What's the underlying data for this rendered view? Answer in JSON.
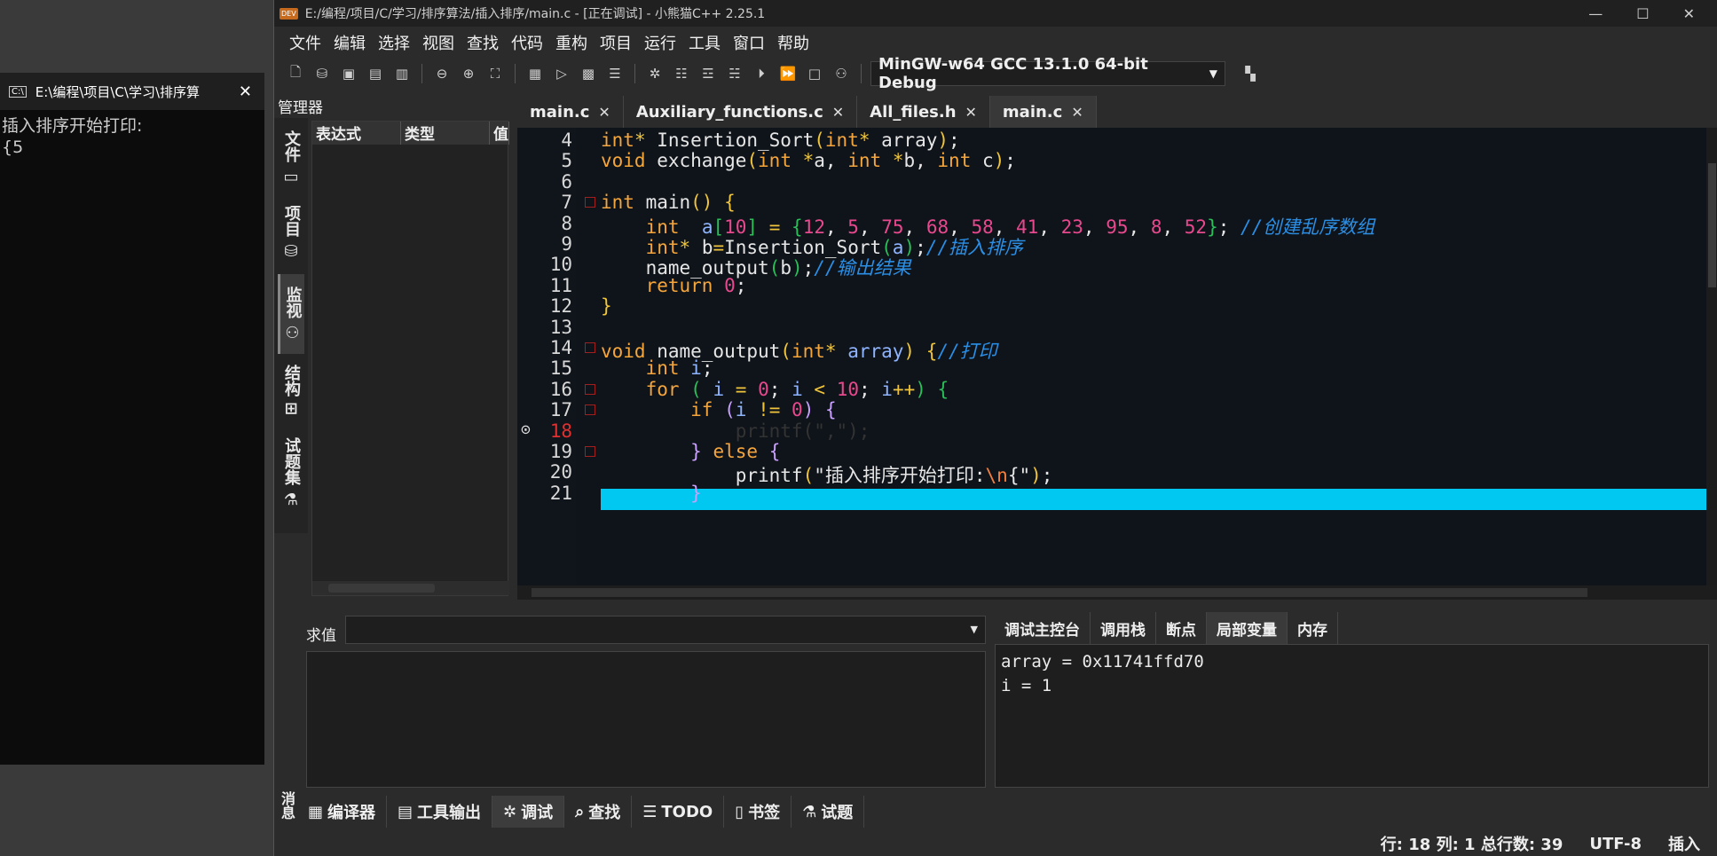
{
  "console": {
    "title": "E:\\编程\\项目\\C\\学习\\排序算",
    "icon_label": "C:\\",
    "lines": "插入排序开始打印:\n{5"
  },
  "window": {
    "title": "E:/编程/项目/C/学习/排序算法/插入排序/main.c - [正在调试] - 小熊猫C++ 2.25.1",
    "logo": "DEV"
  },
  "menu": [
    "文件",
    "编辑",
    "选择",
    "视图",
    "查找",
    "代码",
    "重构",
    "项目",
    "运行",
    "工具",
    "窗口",
    "帮助"
  ],
  "toolbar": {
    "compiler": "MinGW-w64 GCC 13.1.0 64-bit Debug"
  },
  "left_panel": {
    "title": "管理器",
    "vtabs": [
      "文件",
      "项目",
      "监视",
      "结构",
      "试题集"
    ],
    "watch_columns": [
      "表达式",
      "类型",
      "值"
    ]
  },
  "tabs": [
    {
      "label": "main.c",
      "active": false
    },
    {
      "label": "Auxiliary_functions.c",
      "active": false
    },
    {
      "label": "All_files.h",
      "active": false
    },
    {
      "label": "main.c",
      "active": true
    }
  ],
  "editor": {
    "line_numbers": [
      "4",
      "5",
      "6",
      "7",
      "8",
      "9",
      "10",
      "11",
      "12",
      "13",
      "14",
      "15",
      "16",
      "17",
      "18",
      "19",
      "20",
      "21"
    ],
    "current_line": "18",
    "highlight_color": "#00c8f0"
  },
  "bottom": {
    "eval_label": "求值",
    "debug_tabs": [
      "调试主控台",
      "调用栈",
      "断点",
      "局部变量",
      "内存"
    ],
    "locals": "array = 0x11741ffd70\ni = 1",
    "message_label": "消息",
    "tabs": [
      "编译器",
      "工具输出",
      "调试",
      "查找",
      "TODO",
      "书签",
      "试题"
    ]
  },
  "status": {
    "position": "行: 18 列: 1 总行数: 39",
    "encoding": "UTF-8",
    "mode": "插入"
  }
}
